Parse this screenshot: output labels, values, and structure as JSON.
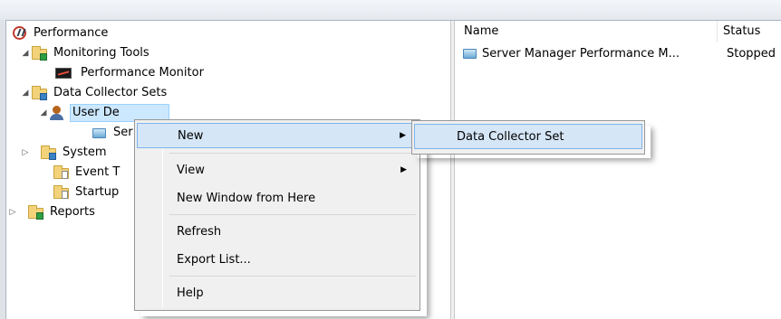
{
  "tree": {
    "root": "Performance",
    "monitoring_tools": "Monitoring Tools",
    "performance_monitor": "Performance Monitor",
    "data_collector_sets": "Data Collector Sets",
    "user_defined": "User De",
    "server_item": "Ser",
    "system": "System",
    "event_trace": "Event T",
    "startup": "Startup",
    "reports": "Reports"
  },
  "list": {
    "columns": [
      "Name",
      "Status"
    ],
    "rows": [
      {
        "name": "Server Manager Performance M...",
        "status": "Stopped"
      }
    ]
  },
  "context_menu": {
    "new": "New",
    "view": "View",
    "new_window": "New Window from Here",
    "refresh": "Refresh",
    "export_list": "Export List...",
    "help": "Help"
  },
  "submenu": {
    "data_collector_set": "Data Collector Set"
  },
  "icons": {
    "arrow": "▶",
    "expanded": "◢",
    "collapsed": "▷"
  }
}
